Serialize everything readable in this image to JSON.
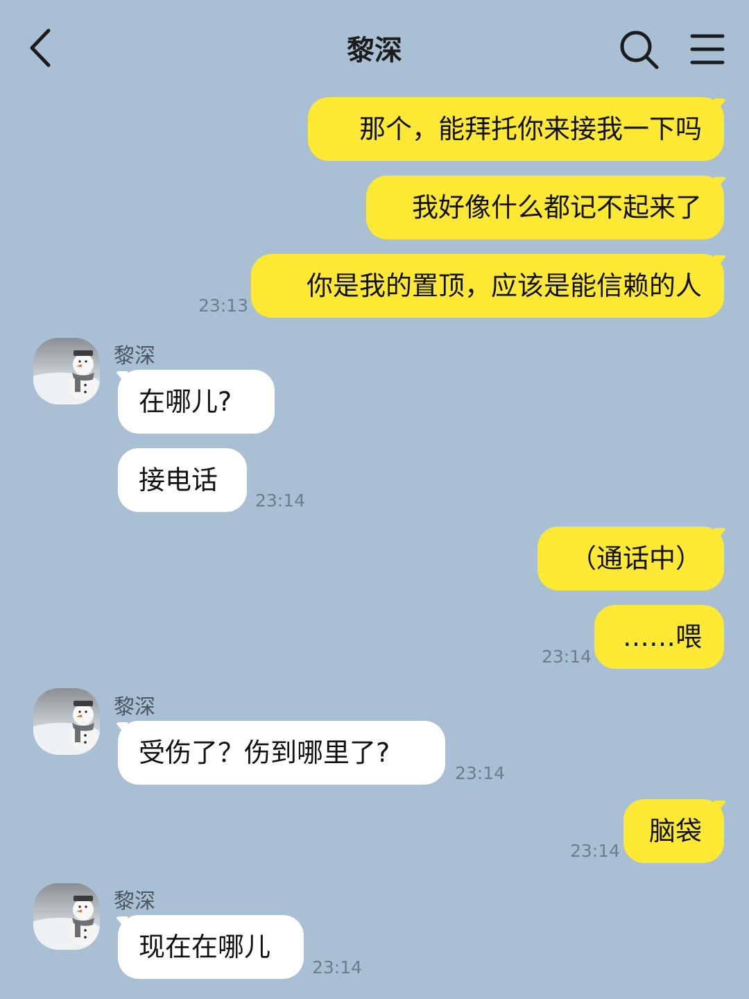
{
  "header": {
    "title": "黎深",
    "back_icon": "chevron-left-icon",
    "search_icon": "search-icon",
    "menu_icon": "hamburger-menu-icon"
  },
  "colors": {
    "background": "#a9bfd3",
    "outgoing_bubble": "#fde933",
    "incoming_bubble": "#ffffff",
    "timestamp": "#6e7d8c"
  },
  "messages": {
    "m1": {
      "text": "那个，能拜托你来接我一下吗",
      "direction": "outgoing"
    },
    "m2": {
      "text": "我好像什么都记不起来了",
      "direction": "outgoing"
    },
    "m3": {
      "text": "你是我的置顶，应该是能信赖的人",
      "direction": "outgoing",
      "time": "23:13"
    },
    "g1": {
      "sender": "黎深",
      "avatar": "snowman-avatar"
    },
    "m4": {
      "text": "在哪儿?",
      "direction": "incoming"
    },
    "m5": {
      "text": "接电话",
      "direction": "incoming",
      "time": "23:14"
    },
    "m6": {
      "text": "（通话中）",
      "direction": "outgoing"
    },
    "m7": {
      "text": "……喂",
      "direction": "outgoing",
      "time": "23:14"
    },
    "g2": {
      "sender": "黎深",
      "avatar": "snowman-avatar"
    },
    "m8": {
      "text": "受伤了？伤到哪里了?",
      "direction": "incoming",
      "time": "23:14"
    },
    "m9": {
      "text": "脑袋",
      "direction": "outgoing",
      "time": "23:14"
    },
    "g3": {
      "sender": "黎深",
      "avatar": "snowman-avatar"
    },
    "m10": {
      "text": "现在在哪儿",
      "direction": "incoming",
      "time": "23:14"
    }
  }
}
